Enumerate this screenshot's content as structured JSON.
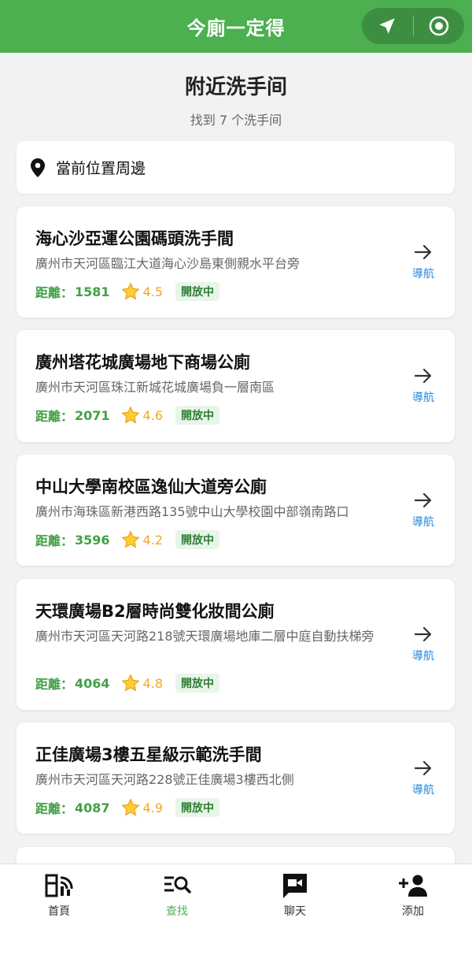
{
  "app": {
    "title": "今廁一定得"
  },
  "header": {
    "title": "附近洗手间",
    "subtitle": "找到 7 个洗手间"
  },
  "location": {
    "label": "當前位置周邊"
  },
  "colors": {
    "brand": "#4caf50",
    "distance": "#43a047",
    "rating": "#f5a623",
    "nav": "#1e88e5"
  },
  "results": [
    {
      "name": "海心沙亞運公園碼頭洗手間",
      "address": "廣州市天河區臨江大道海心沙島東側親水平台旁",
      "distance_label": "距離：",
      "distance": "1581",
      "rating": "4.5",
      "status": "開放中",
      "nav_label": "導航"
    },
    {
      "name": "廣州塔花城廣場地下商場公廁",
      "address": "廣州市天河區珠江新城花城廣場負一層南區",
      "distance_label": "距離：",
      "distance": "2071",
      "rating": "4.6",
      "status": "開放中",
      "nav_label": "導航"
    },
    {
      "name": "中山大學南校區逸仙大道旁公廁",
      "address": "廣州市海珠區新港西路135號中山大學校園中部嶺南路口",
      "distance_label": "距離：",
      "distance": "3596",
      "rating": "4.2",
      "status": "開放中",
      "nav_label": "導航"
    },
    {
      "name": "天環廣場B2層時尚雙化妝間公廁",
      "address": "廣州市天河區天河路218號天環廣場地庫二層中庭自動扶梯旁",
      "distance_label": "距離：",
      "distance": "4064",
      "rating": "4.8",
      "status": "開放中",
      "nav_label": "導航"
    },
    {
      "name": "正佳廣場3樓五星級示範洗手間",
      "address": "廣州市天河區天河路228號正佳廣場3樓西北側",
      "distance_label": "距離：",
      "distance": "4087",
      "rating": "4.9",
      "status": "開放中",
      "nav_label": "導航"
    }
  ],
  "tabs": [
    {
      "label": "首頁",
      "icon": "home-icon"
    },
    {
      "label": "查找",
      "icon": "search-list-icon",
      "active": true
    },
    {
      "label": "聊天",
      "icon": "chat-video-icon"
    },
    {
      "label": "添加",
      "icon": "add-person-icon"
    }
  ]
}
